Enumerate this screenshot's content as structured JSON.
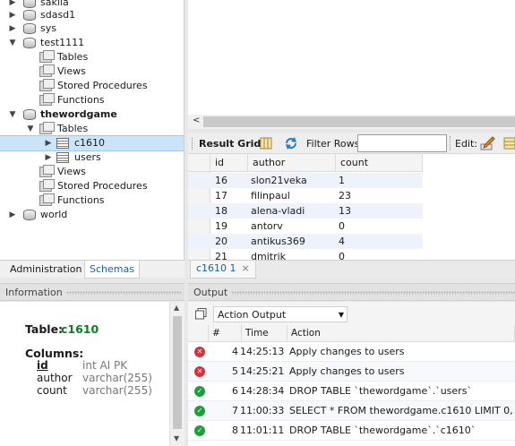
{
  "navigator": {
    "items": [
      {
        "label": "sakila",
        "level": 0,
        "icon": "database-icon",
        "expanded": false
      },
      {
        "label": "sdasd1",
        "level": 0,
        "icon": "database-icon",
        "expanded": false
      },
      {
        "label": "sys",
        "level": 0,
        "icon": "database-icon",
        "expanded": false
      },
      {
        "label": "test1111",
        "level": 0,
        "icon": "database-icon",
        "expanded": true
      },
      {
        "label": "Tables",
        "level": 1,
        "icon": "folder-icon"
      },
      {
        "label": "Views",
        "level": 1,
        "icon": "folder-icon"
      },
      {
        "label": "Stored Procedures",
        "level": 1,
        "icon": "folder-icon"
      },
      {
        "label": "Functions",
        "level": 1,
        "icon": "folder-icon"
      },
      {
        "label": "thewordgame",
        "level": 0,
        "icon": "database-icon",
        "expanded": true,
        "bold": true
      },
      {
        "label": "Tables",
        "level": 1,
        "icon": "folder-icon",
        "expanded": true
      },
      {
        "label": "c1610",
        "level": 2,
        "icon": "table-icon",
        "selected": true
      },
      {
        "label": "users",
        "level": 2,
        "icon": "table-icon"
      },
      {
        "label": "Views",
        "level": 1,
        "icon": "folder-icon"
      },
      {
        "label": "Stored Procedures",
        "level": 1,
        "icon": "folder-icon"
      },
      {
        "label": "Functions",
        "level": 1,
        "icon": "folder-icon"
      },
      {
        "label": "world",
        "level": 0,
        "icon": "database-icon",
        "expanded": false
      }
    ],
    "tabs": {
      "administration": "Administration",
      "schemas": "Schemas"
    }
  },
  "information": {
    "title": "Information",
    "table_label": "Table:",
    "table_name": "c1610",
    "columns_label": "Columns:",
    "columns": [
      {
        "name": "id",
        "type": "int AI PK"
      },
      {
        "name": "author",
        "type": "varchar(255)"
      },
      {
        "name": "count",
        "type": "varchar(255)"
      }
    ]
  },
  "result_toolbar": {
    "result_grid": "Result Grid",
    "filter_rows": "Filter Rows:",
    "filter_value": "",
    "edit": "Edit:"
  },
  "grid": {
    "headers": [
      "id",
      "author",
      "count"
    ],
    "rows": [
      [
        "16",
        "slon21veka",
        "1"
      ],
      [
        "17",
        "filinpaul",
        "23"
      ],
      [
        "18",
        "alena-vladi",
        "13"
      ],
      [
        "19",
        "antorv",
        "0"
      ],
      [
        "20",
        "antikus369",
        "4"
      ],
      [
        "21",
        "dmitrik",
        "0"
      ]
    ]
  },
  "result_tab": {
    "label": "c1610 1",
    "close": "×"
  },
  "output": {
    "title": "Output",
    "selector": "Action Output",
    "headers": [
      "#",
      "Time",
      "Action"
    ],
    "rows": [
      {
        "status": "error",
        "num": "4",
        "time": "14:25:13",
        "action": "Apply changes to users"
      },
      {
        "status": "error",
        "num": "5",
        "time": "14:25:21",
        "action": "Apply changes to users"
      },
      {
        "status": "ok",
        "num": "6",
        "time": "14:28:34",
        "action": "DROP TABLE `thewordgame`.`users`"
      },
      {
        "status": "ok",
        "num": "7",
        "time": "11:00:33",
        "action": "SELECT * FROM thewordgame.c1610 LIMIT 0, 1000"
      },
      {
        "status": "ok",
        "num": "8",
        "time": "11:01:11",
        "action": "DROP TABLE `thewordgame`.`c1610`"
      }
    ]
  },
  "colors": {
    "accent": "#1d5fa6",
    "table_name": "#0a7d1f",
    "error": "#d13438",
    "success": "#1e9e3a"
  }
}
